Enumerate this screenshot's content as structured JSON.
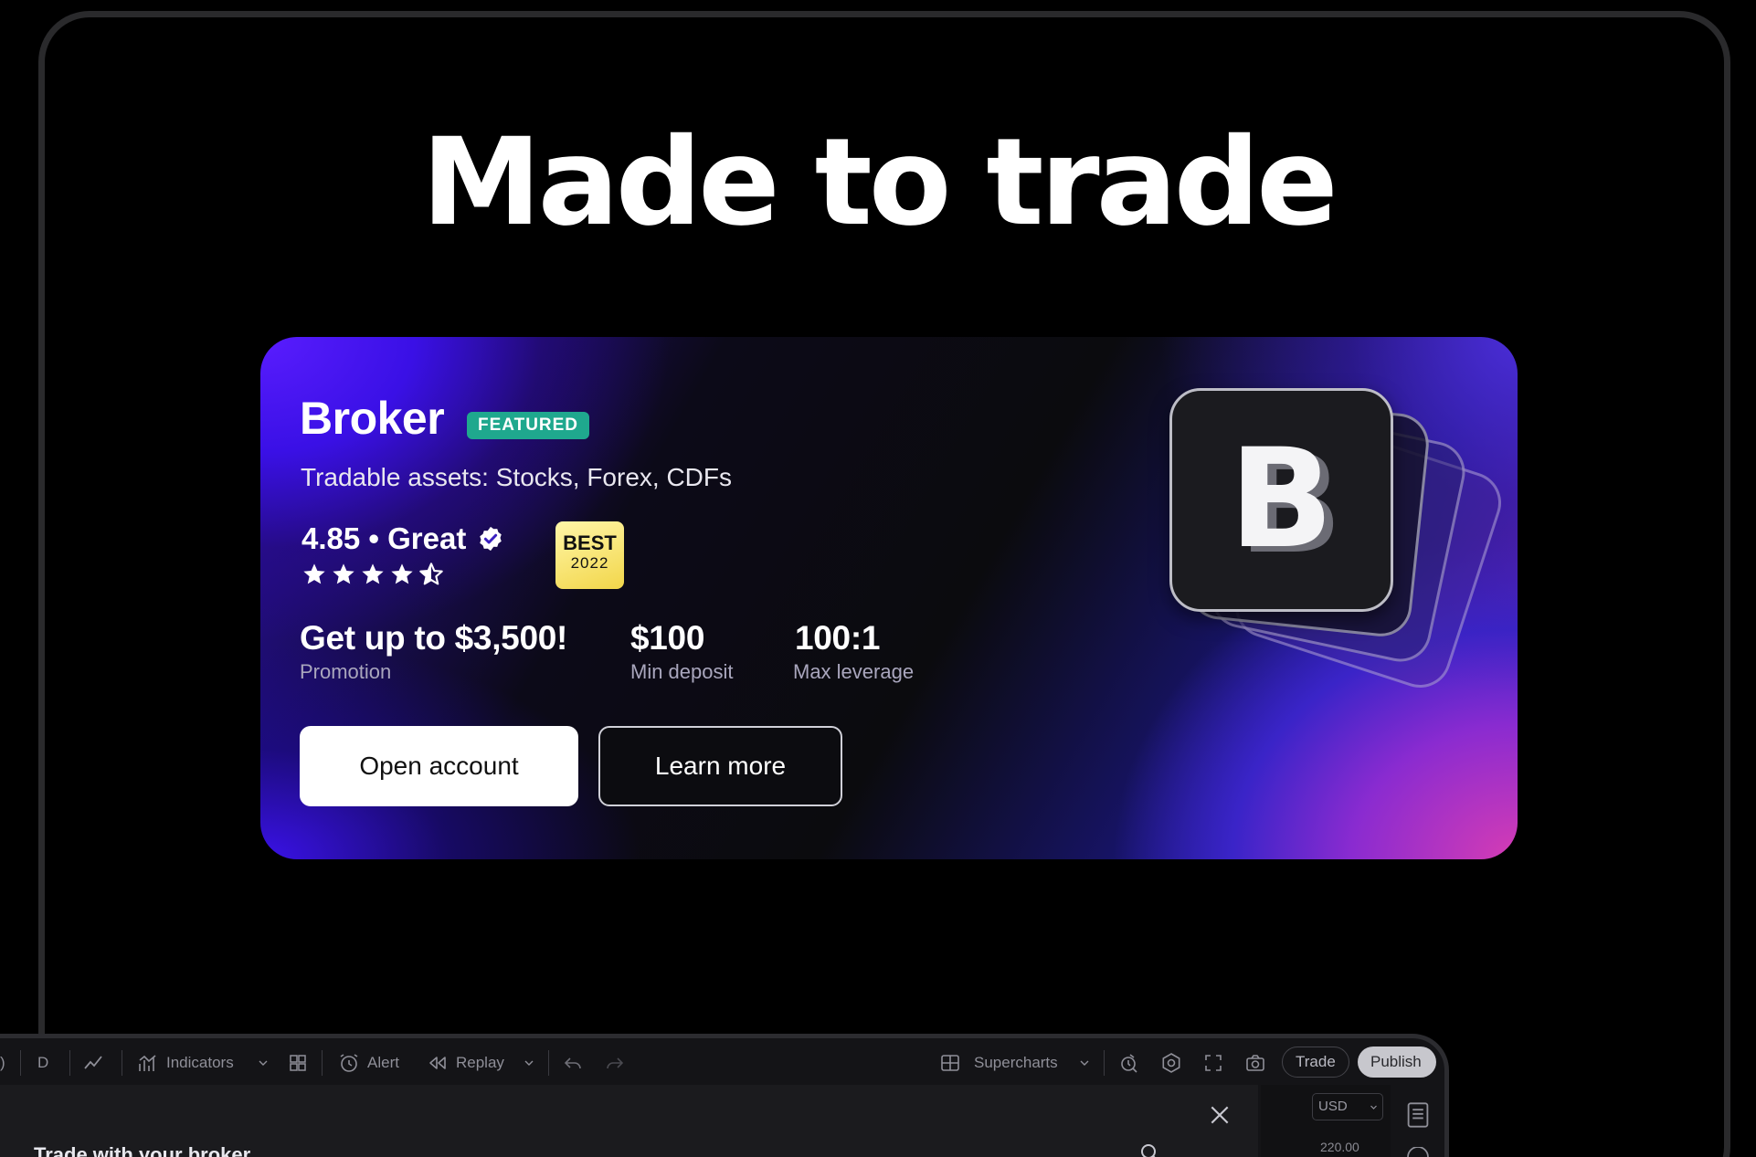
{
  "headline": "Made to trade",
  "broker_card": {
    "name": "Broker",
    "badge": "FEATURED",
    "assets": "Tradable assets: Stocks, Forex, CDFs",
    "rating_text": "4.85 • Great",
    "rating_value": 4.85,
    "stars_filled": 4.5,
    "stars_total": 5,
    "award_line1": "BEST",
    "award_line2": "2022",
    "stats": [
      {
        "value": "Get up to $3,500!",
        "label": "Promotion"
      },
      {
        "value": "$100",
        "label": "Min deposit"
      },
      {
        "value": "100:1",
        "label": "Max leverage"
      }
    ],
    "primary_button": "Open account",
    "secondary_button": "Learn more",
    "logo_letter": "B"
  },
  "toolbar": {
    "interval": "D",
    "indicators": "Indicators",
    "alert": "Alert",
    "replay": "Replay",
    "supercharts": "Supercharts",
    "trade": "Trade",
    "publish": "Publish"
  },
  "panel": {
    "title": "Trade with your broker",
    "currency": "USD",
    "price_tick": "220.00"
  },
  "colors": {
    "featured_badge": "#1fa88e",
    "award_badge": "#f2d64a",
    "card_accent_purple": "#5a1dff",
    "card_accent_pink": "#d63cb4"
  }
}
